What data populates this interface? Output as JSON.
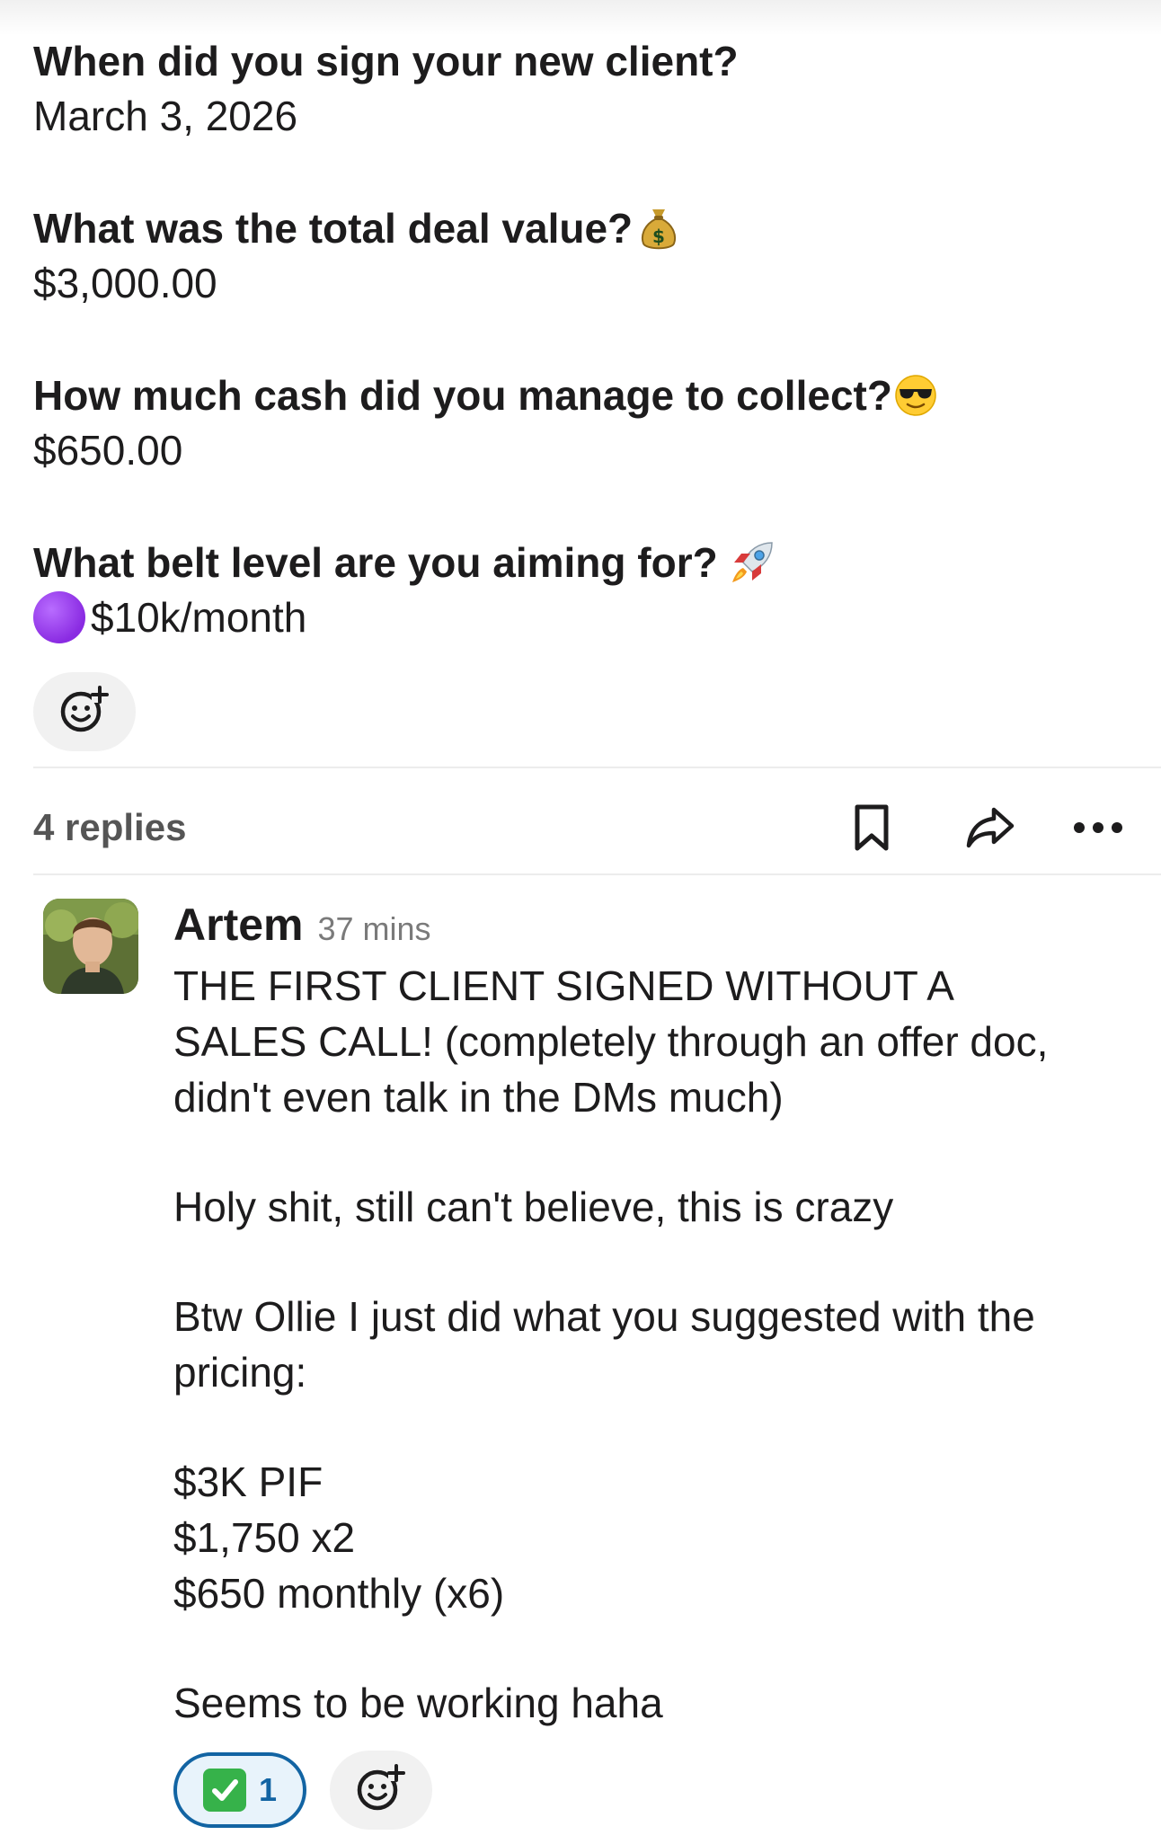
{
  "form": {
    "items": [
      {
        "question": "When did you sign your new client?",
        "answer": "March 3, 2026",
        "emoji": ""
      },
      {
        "question": "What was the total deal value?",
        "answer": "$3,000.00",
        "emoji": "money-bag-icon"
      },
      {
        "question": "How much cash did you manage to collect?",
        "answer": "$650.00",
        "emoji": "sunglasses-face-icon"
      },
      {
        "question": "What belt level are you aiming for?",
        "answer": "$10k/month",
        "emoji": "rocket-icon",
        "answer_prefix": "purple-circle-icon"
      }
    ]
  },
  "thread_bar": {
    "replies": "4 replies",
    "icons": [
      "bookmark-icon",
      "share-icon",
      "more-icon"
    ]
  },
  "reply": {
    "author": "Artem",
    "time": "37 mins",
    "paragraphs": [
      [
        "THE FIRST CLIENT SIGNED WITHOUT A",
        "SALES CALL! (completely through an offer doc,",
        "didn't even talk in the DMs much)"
      ],
      [
        "Holy shit, still can't believe, this is crazy"
      ],
      [
        "Btw Ollie I just did what you suggested with the",
        "pricing:"
      ],
      [
        "$3K PIF",
        "$1,750 x2",
        "$650 monthly (x6)"
      ],
      [
        "Seems to be working haha"
      ]
    ],
    "reaction": {
      "emoji": "check-mark-button-icon",
      "count": "1"
    }
  },
  "colors": {
    "text": "#1d1c1d",
    "muted": "#7a7a7a",
    "reaction_border": "#1264a3",
    "reaction_bg": "#e8f3fb",
    "pill_bg": "#f1f1f1"
  }
}
